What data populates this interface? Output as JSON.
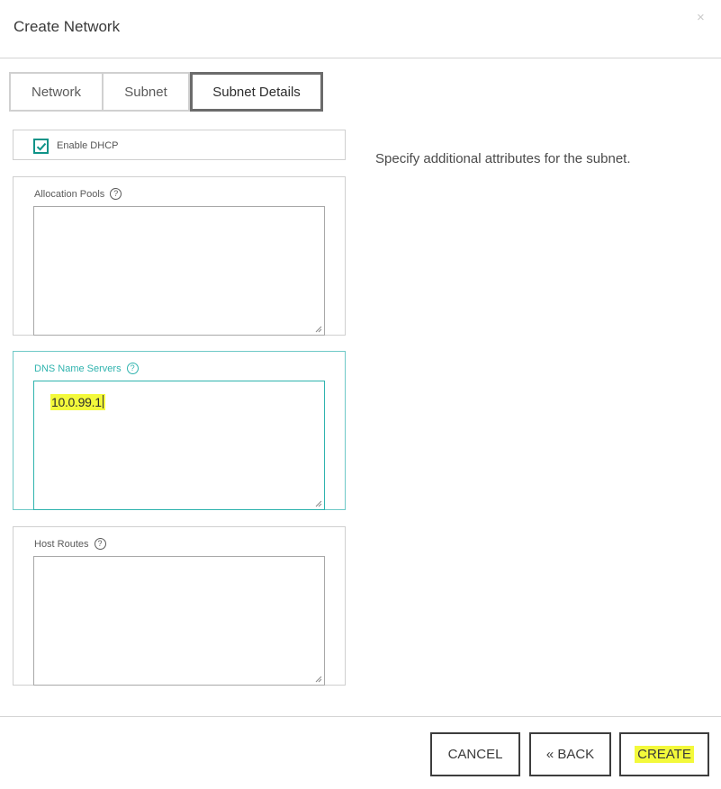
{
  "dialog": {
    "title": "Create Network",
    "close_label": "×"
  },
  "tabs": [
    {
      "label": "Network",
      "active": false
    },
    {
      "label": "Subnet",
      "active": false
    },
    {
      "label": "Subnet Details",
      "active": true
    }
  ],
  "form": {
    "enable_dhcp": {
      "label": "Enable DHCP",
      "checked": true
    },
    "allocation_pools": {
      "label": "Allocation Pools",
      "help_icon": "?",
      "value": ""
    },
    "dns_name_servers": {
      "label": "DNS Name Servers",
      "help_icon": "?",
      "value": "10.0.99.1",
      "focused": true
    },
    "host_routes": {
      "label": "Host Routes",
      "help_icon": "?",
      "value": ""
    }
  },
  "description": "Specify additional attributes for the subnet.",
  "footer": {
    "cancel_label": "CANCEL",
    "back_label": "« BACK",
    "create_label": "CREATE"
  },
  "colors": {
    "accent": "#2fb3ae",
    "checkbox": "#0f9388",
    "highlight": "#f3f93b"
  }
}
